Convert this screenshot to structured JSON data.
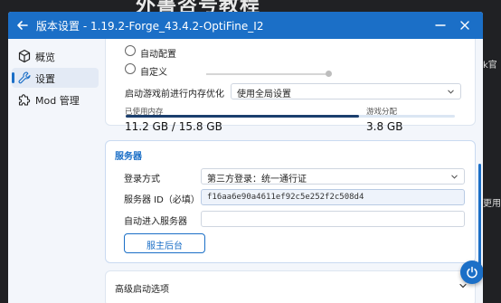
{
  "background": {
    "heading": "外書咨号教程",
    "edge_text_1": "k官",
    "edge_text_2": "更用"
  },
  "titlebar": {
    "title": "版本设置 - 1.19.2-Forge_43.4.2-OptiFine_I2",
    "back_icon": "arrow-left-icon",
    "minimize_icon": "minimize-icon",
    "close_icon": "close-icon"
  },
  "sidebar": {
    "items": [
      {
        "label": "概览",
        "icon": "cube-icon",
        "active": false
      },
      {
        "label": "设置",
        "icon": "wrench-icon",
        "active": true
      },
      {
        "label": "Mod 管理",
        "icon": "puzzle-icon",
        "active": false
      }
    ]
  },
  "memory": {
    "option_auto": "自动配置",
    "option_custom": "自定义",
    "optimize_label": "启动游戏前进行内存优化",
    "optimize_value": "使用全局设置",
    "used_label": "已使用内存",
    "used_value": "11.2 GB / 15.8 GB",
    "alloc_label": "游戏分配",
    "alloc_value": "3.8 GB",
    "used_fraction": 0.709
  },
  "server": {
    "title": "服务器",
    "login_label": "登录方式",
    "login_value": "第三方登录：统一通行证",
    "server_id_label": "服务器 ID（必填）",
    "server_id_value": "f16aa6e90a4611ef92c5e252f2c508d4",
    "auto_join_label": "自动进入服务器",
    "auto_join_value": "",
    "backend_button": "服主后台"
  },
  "advanced": {
    "title": "高级启动选项"
  },
  "colors": {
    "accent": "#1b6fc7",
    "titlebar": "#1b6fc7",
    "memory_fill": "#1b3f6e"
  }
}
